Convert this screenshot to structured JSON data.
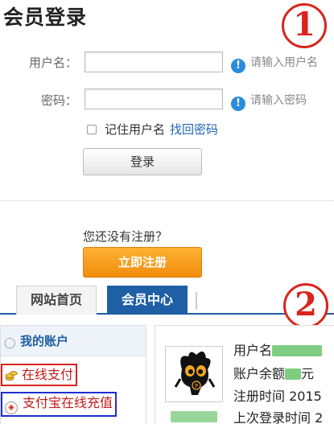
{
  "login": {
    "title": "会员登录",
    "username_label": "用户名：",
    "password_label": "密码：",
    "username_hint": "请输入用户名",
    "password_hint": "请输入密码",
    "remember_label": "记住用户名",
    "forgot_link": "找回密码",
    "login_button": "登录",
    "no_account_text": "您还没有注册？",
    "register_button": "立即注册"
  },
  "annotations": {
    "badge_1": "1",
    "badge_2": "2"
  },
  "nav": {
    "tabs": [
      {
        "label": "网站首页",
        "active": false
      },
      {
        "label": "会员中心",
        "active": true
      }
    ]
  },
  "sidebar": {
    "heading": "我的账户",
    "links": [
      {
        "label": "在线支付"
      },
      {
        "label": "支付宝在线充值"
      }
    ]
  },
  "account": {
    "username_label": "用户名",
    "balance_label": "账户余额",
    "balance_unit": "元",
    "register_time_label": "注册时间",
    "register_time_value": "2015",
    "last_login_label": "上次登录时间",
    "last_login_value": "2"
  },
  "colors": {
    "accent_blue": "#1e5fa6",
    "register_orange": "#f08c0c",
    "annotation_red": "#d9241c",
    "redaction_green": "#69c46b"
  }
}
